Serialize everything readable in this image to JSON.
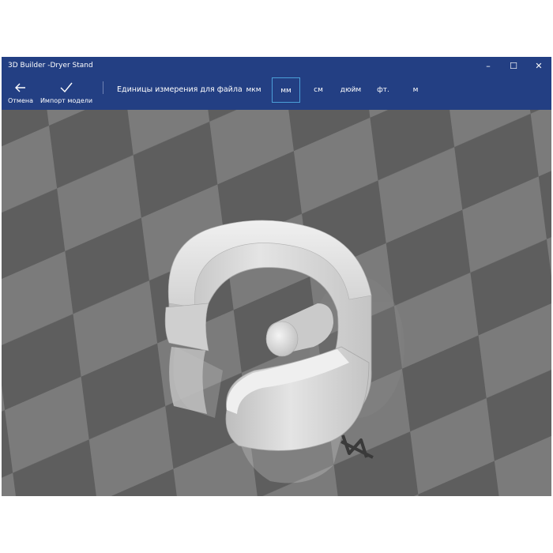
{
  "window": {
    "title": "3D Builder -Dryer Stand",
    "controls": {
      "minimize": "–",
      "maximize": "☐",
      "close": "✕"
    }
  },
  "toolbar": {
    "cancel_label": "Отмена",
    "import_label": "Импорт модели",
    "units_label": "Единицы измерения для файла",
    "units": [
      "мкм",
      "мм",
      "см",
      "дюйм",
      "фт.",
      "м"
    ],
    "selected_unit": "мм"
  },
  "colors": {
    "titlebar": "#233f83",
    "selected_unit_border": "#4b9fd8",
    "grid_dark": "#5e5e5e",
    "grid_light": "#7b7b7b",
    "model": "#d9d9d9"
  }
}
